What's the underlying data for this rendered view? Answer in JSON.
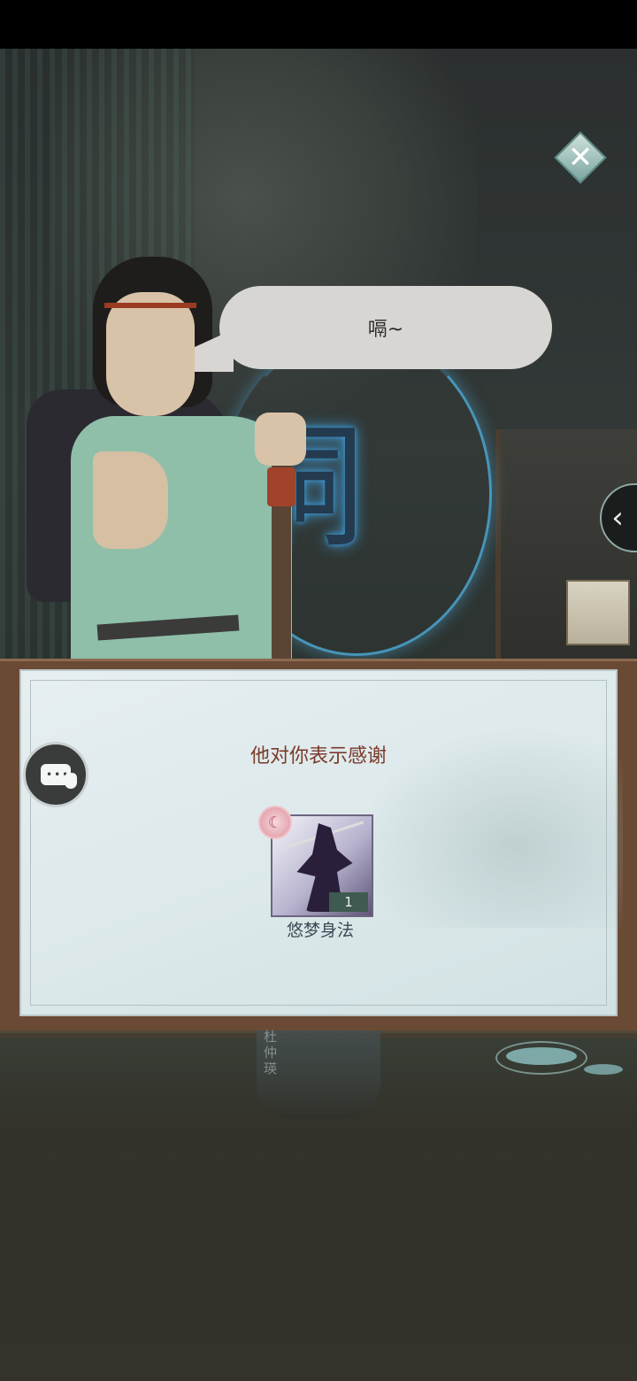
{
  "dialog": {
    "speech": "嗝~"
  },
  "reward_panel": {
    "title": "他对你表示感谢",
    "item": {
      "name": "悠梦身法",
      "count": "1"
    }
  },
  "reflection": {
    "label": "杜仲瑛"
  },
  "icons": {
    "close": "close-icon",
    "side_tab": "chevron-left-icon",
    "chat": "chat-bubble-icon",
    "item_badge": "moon-badge-icon"
  },
  "colors": {
    "panel_title": "#7a3a2a",
    "portal_glow": "#3ea0e0",
    "panel_frame": "#6b4a35"
  }
}
